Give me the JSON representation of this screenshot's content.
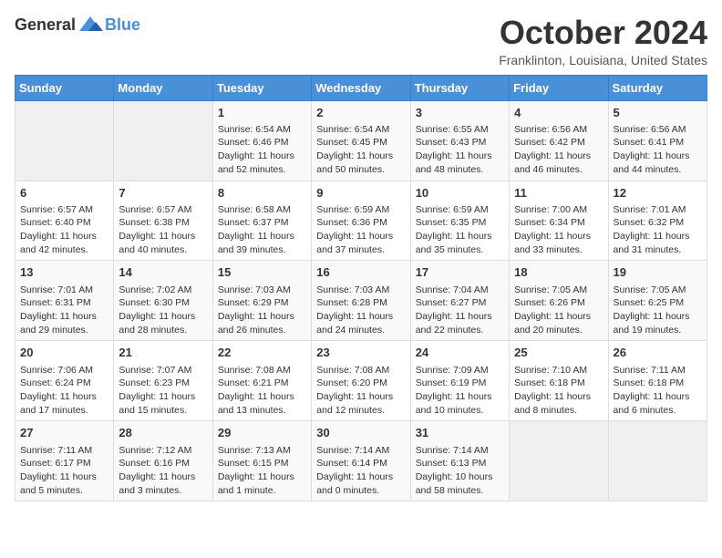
{
  "logo": {
    "general": "General",
    "blue": "Blue"
  },
  "title": "October 2024",
  "location": "Franklinton, Louisiana, United States",
  "days_of_week": [
    "Sunday",
    "Monday",
    "Tuesday",
    "Wednesday",
    "Thursday",
    "Friday",
    "Saturday"
  ],
  "weeks": [
    [
      {
        "day": "",
        "content": ""
      },
      {
        "day": "",
        "content": ""
      },
      {
        "day": "1",
        "content": "Sunrise: 6:54 AM\nSunset: 6:46 PM\nDaylight: 11 hours and 52 minutes."
      },
      {
        "day": "2",
        "content": "Sunrise: 6:54 AM\nSunset: 6:45 PM\nDaylight: 11 hours and 50 minutes."
      },
      {
        "day": "3",
        "content": "Sunrise: 6:55 AM\nSunset: 6:43 PM\nDaylight: 11 hours and 48 minutes."
      },
      {
        "day": "4",
        "content": "Sunrise: 6:56 AM\nSunset: 6:42 PM\nDaylight: 11 hours and 46 minutes."
      },
      {
        "day": "5",
        "content": "Sunrise: 6:56 AM\nSunset: 6:41 PM\nDaylight: 11 hours and 44 minutes."
      }
    ],
    [
      {
        "day": "6",
        "content": "Sunrise: 6:57 AM\nSunset: 6:40 PM\nDaylight: 11 hours and 42 minutes."
      },
      {
        "day": "7",
        "content": "Sunrise: 6:57 AM\nSunset: 6:38 PM\nDaylight: 11 hours and 40 minutes."
      },
      {
        "day": "8",
        "content": "Sunrise: 6:58 AM\nSunset: 6:37 PM\nDaylight: 11 hours and 39 minutes."
      },
      {
        "day": "9",
        "content": "Sunrise: 6:59 AM\nSunset: 6:36 PM\nDaylight: 11 hours and 37 minutes."
      },
      {
        "day": "10",
        "content": "Sunrise: 6:59 AM\nSunset: 6:35 PM\nDaylight: 11 hours and 35 minutes."
      },
      {
        "day": "11",
        "content": "Sunrise: 7:00 AM\nSunset: 6:34 PM\nDaylight: 11 hours and 33 minutes."
      },
      {
        "day": "12",
        "content": "Sunrise: 7:01 AM\nSunset: 6:32 PM\nDaylight: 11 hours and 31 minutes."
      }
    ],
    [
      {
        "day": "13",
        "content": "Sunrise: 7:01 AM\nSunset: 6:31 PM\nDaylight: 11 hours and 29 minutes."
      },
      {
        "day": "14",
        "content": "Sunrise: 7:02 AM\nSunset: 6:30 PM\nDaylight: 11 hours and 28 minutes."
      },
      {
        "day": "15",
        "content": "Sunrise: 7:03 AM\nSunset: 6:29 PM\nDaylight: 11 hours and 26 minutes."
      },
      {
        "day": "16",
        "content": "Sunrise: 7:03 AM\nSunset: 6:28 PM\nDaylight: 11 hours and 24 minutes."
      },
      {
        "day": "17",
        "content": "Sunrise: 7:04 AM\nSunset: 6:27 PM\nDaylight: 11 hours and 22 minutes."
      },
      {
        "day": "18",
        "content": "Sunrise: 7:05 AM\nSunset: 6:26 PM\nDaylight: 11 hours and 20 minutes."
      },
      {
        "day": "19",
        "content": "Sunrise: 7:05 AM\nSunset: 6:25 PM\nDaylight: 11 hours and 19 minutes."
      }
    ],
    [
      {
        "day": "20",
        "content": "Sunrise: 7:06 AM\nSunset: 6:24 PM\nDaylight: 11 hours and 17 minutes."
      },
      {
        "day": "21",
        "content": "Sunrise: 7:07 AM\nSunset: 6:23 PM\nDaylight: 11 hours and 15 minutes."
      },
      {
        "day": "22",
        "content": "Sunrise: 7:08 AM\nSunset: 6:21 PM\nDaylight: 11 hours and 13 minutes."
      },
      {
        "day": "23",
        "content": "Sunrise: 7:08 AM\nSunset: 6:20 PM\nDaylight: 11 hours and 12 minutes."
      },
      {
        "day": "24",
        "content": "Sunrise: 7:09 AM\nSunset: 6:19 PM\nDaylight: 11 hours and 10 minutes."
      },
      {
        "day": "25",
        "content": "Sunrise: 7:10 AM\nSunset: 6:18 PM\nDaylight: 11 hours and 8 minutes."
      },
      {
        "day": "26",
        "content": "Sunrise: 7:11 AM\nSunset: 6:18 PM\nDaylight: 11 hours and 6 minutes."
      }
    ],
    [
      {
        "day": "27",
        "content": "Sunrise: 7:11 AM\nSunset: 6:17 PM\nDaylight: 11 hours and 5 minutes."
      },
      {
        "day": "28",
        "content": "Sunrise: 7:12 AM\nSunset: 6:16 PM\nDaylight: 11 hours and 3 minutes."
      },
      {
        "day": "29",
        "content": "Sunrise: 7:13 AM\nSunset: 6:15 PM\nDaylight: 11 hours and 1 minute."
      },
      {
        "day": "30",
        "content": "Sunrise: 7:14 AM\nSunset: 6:14 PM\nDaylight: 11 hours and 0 minutes."
      },
      {
        "day": "31",
        "content": "Sunrise: 7:14 AM\nSunset: 6:13 PM\nDaylight: 10 hours and 58 minutes."
      },
      {
        "day": "",
        "content": ""
      },
      {
        "day": "",
        "content": ""
      }
    ]
  ]
}
